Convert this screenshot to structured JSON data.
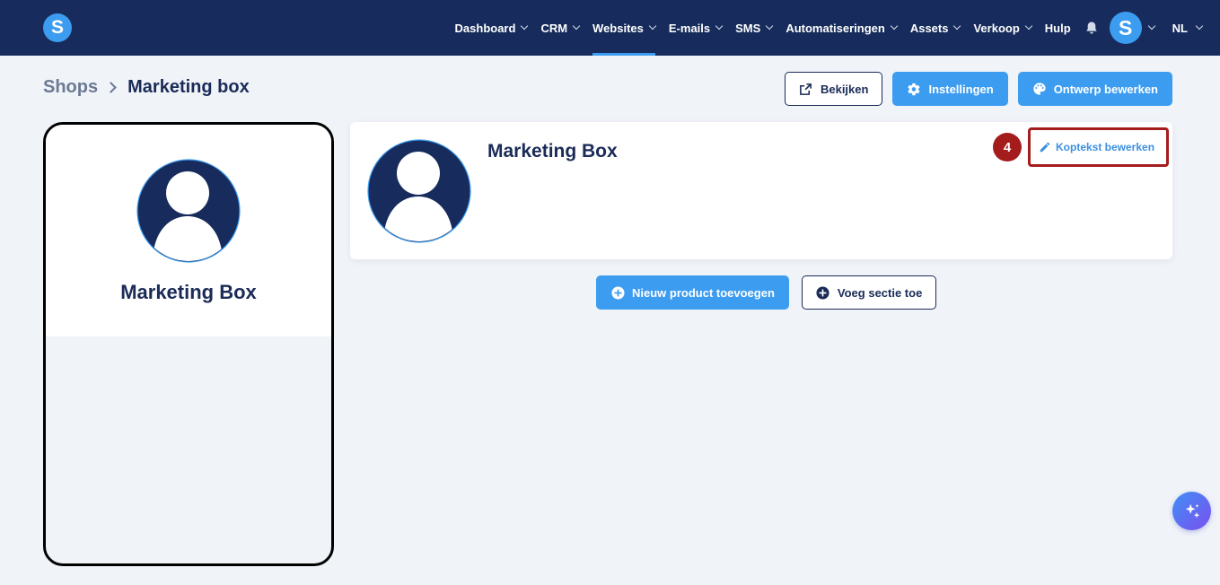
{
  "app": {
    "logo_letter": "S"
  },
  "nav": {
    "items": [
      {
        "label": "Dashboard",
        "dropdown": true,
        "active": false
      },
      {
        "label": "CRM",
        "dropdown": true,
        "active": false
      },
      {
        "label": "Websites",
        "dropdown": true,
        "active": true
      },
      {
        "label": "E-mails",
        "dropdown": true,
        "active": false
      },
      {
        "label": "SMS",
        "dropdown": true,
        "active": false
      },
      {
        "label": "Automatiseringen",
        "dropdown": true,
        "active": false
      },
      {
        "label": "Assets",
        "dropdown": true,
        "active": false
      },
      {
        "label": "Verkoop",
        "dropdown": true,
        "active": false
      },
      {
        "label": "Hulp",
        "dropdown": false,
        "active": false
      }
    ],
    "bell_icon": "bell-icon",
    "user_initial": "S",
    "language": "NL"
  },
  "breadcrumb": {
    "parent": "Shops",
    "current": "Marketing box"
  },
  "actions": {
    "view": "Bekijken",
    "settings": "Instellingen",
    "edit_design": "Ontwerp bewerken"
  },
  "preview": {
    "name": "Marketing Box"
  },
  "header_card": {
    "title": "Marketing Box",
    "step_number": "4",
    "edit_label": "Koptekst bewerken"
  },
  "content_actions": {
    "add_product": "Nieuw product toevoegen",
    "add_section": "Voeg sectie toe"
  },
  "colors": {
    "navbar": "#172c5c",
    "primary": "#3c9cf0",
    "text_dark": "#1a2b57",
    "highlight": "#a51c1c",
    "background": "#f0f3f8"
  }
}
